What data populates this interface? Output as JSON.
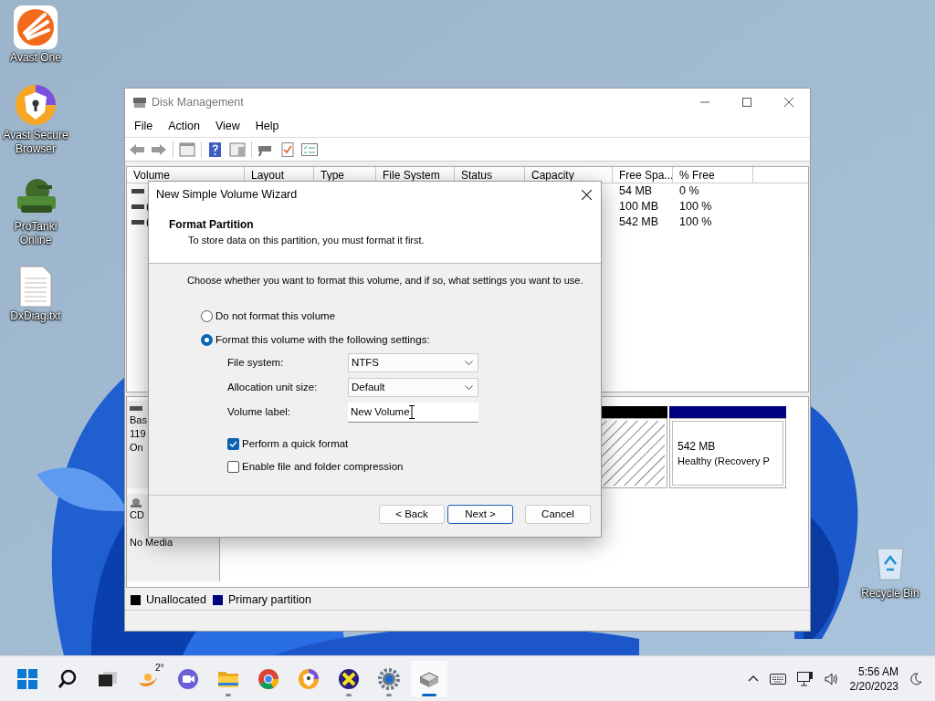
{
  "desktop_icons": [
    {
      "kind": "avast-one",
      "label": "Avast One"
    },
    {
      "kind": "secure-browser",
      "label": "Avast Secure Browser"
    },
    {
      "kind": "tank-game",
      "label": "ProTanki Online"
    },
    {
      "kind": "text-file",
      "label": "DxDiag.txt"
    }
  ],
  "recycle_bin": {
    "label": "Recycle Bin"
  },
  "window": {
    "title": "Disk Management",
    "menu": [
      "File",
      "Action",
      "View",
      "Help"
    ],
    "columns": [
      "Volume",
      "Layout",
      "Type",
      "File System",
      "Status",
      "Capacity",
      "Free Spa...",
      "% Free"
    ],
    "rows": [
      {
        "free_space": "54 MB",
        "percent_free": "0 %"
      },
      {
        "volume": "(",
        "free_space": "100 MB",
        "percent_free": "100 %"
      },
      {
        "volume": "(",
        "free_space": "542 MB",
        "percent_free": "100 %"
      }
    ],
    "disks": [
      {
        "kind": "hard-disk",
        "lines": [
          "Bas",
          "119",
          "On"
        ],
        "partitions": [
          {
            "color": "#000000",
            "selected": true
          },
          {
            "color": "#000080",
            "selected": false,
            "size": "542 MB",
            "status": "Healthy (Recovery P"
          }
        ]
      },
      {
        "kind": "cd-drive",
        "lines": [
          "CD",
          "No Media"
        ]
      }
    ],
    "legend": [
      {
        "label": "Unallocated",
        "color": "#000000"
      },
      {
        "label": "Primary partition",
        "color": "#000080"
      }
    ]
  },
  "dialog": {
    "title": "New Simple Volume Wizard",
    "heading": "Format Partition",
    "subheading": "To store data on this partition, you must format it first.",
    "instruction": "Choose whether you want to format this volume, and if so, what settings you want to use.",
    "options": [
      {
        "label": "Do not format this volume",
        "selected": false
      },
      {
        "label": "Format this volume with the following settings:",
        "selected": true
      }
    ],
    "fields": [
      {
        "kind": "dropdown",
        "label": "File system:",
        "value": "NTFS"
      },
      {
        "kind": "dropdown",
        "label": "Allocation unit size:",
        "value": "Default"
      },
      {
        "kind": "text",
        "label": "Volume label:",
        "value": "New Volume"
      }
    ],
    "checkboxes": [
      {
        "label": "Perform a quick format",
        "checked": true
      },
      {
        "label": "Enable file and folder compression",
        "checked": false
      }
    ],
    "buttons": [
      {
        "label": "< Back",
        "focused": false
      },
      {
        "label": "Next >",
        "focused": true
      },
      {
        "label": "Cancel",
        "focused": false
      }
    ]
  },
  "taskbar": {
    "apps": [
      {
        "kind": "start",
        "running": false,
        "selected": false
      },
      {
        "kind": "search",
        "running": false,
        "selected": false
      },
      {
        "kind": "task-view",
        "running": false,
        "selected": false
      },
      {
        "kind": "weather",
        "badge": "2°",
        "running": false,
        "selected": false
      },
      {
        "kind": "chat",
        "running": false,
        "selected": false
      },
      {
        "kind": "folder",
        "running": true,
        "selected": false
      },
      {
        "kind": "chrome",
        "running": false,
        "selected": false
      },
      {
        "kind": "secure-browser",
        "running": false,
        "selected": false
      },
      {
        "kind": "x-app",
        "running": true,
        "selected": false
      },
      {
        "kind": "settings",
        "running": true,
        "selected": false
      },
      {
        "kind": "disk",
        "running": true,
        "selected": true
      }
    ],
    "time": "5:56 AM",
    "date": "2/20/2023"
  }
}
